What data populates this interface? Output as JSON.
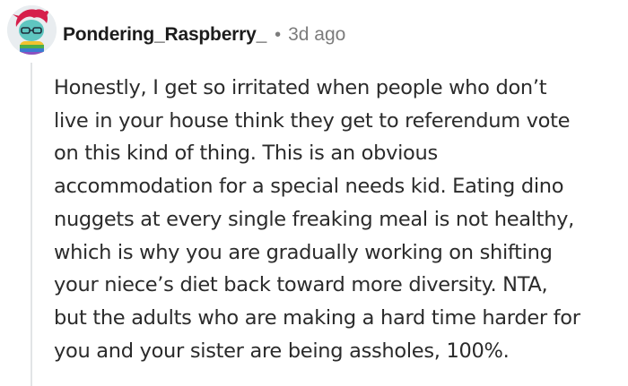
{
  "comment": {
    "username": "Pondering_Raspberry_",
    "separator": "•",
    "timestamp": "3d ago",
    "avatar_icon": "snoo-avatar-icon",
    "body_lines": [
      "Honestly, I get so irritated when people who don’t",
      "live in your house think they get to referendum vote",
      "on this kind of thing. This is an obvious",
      "accommodation for a special needs kid. Eating dino",
      "nuggets at every single freaking meal is not healthy,",
      "which is why you are gradually working on shifting",
      "your niece’s diet back toward more diversity. NTA,",
      "but the adults who are making a hard time harder for",
      "you and your sister are being assholes, 100%."
    ]
  },
  "colors": {
    "username": "#1c1c1c",
    "meta": "#7c7c7c",
    "body": "#2b2b2b",
    "thread_line": "#e2e4e6",
    "avatar_bg": "#e9edf0",
    "avatar_hair": "#d61f4b",
    "avatar_face": "#5fc6c0"
  }
}
